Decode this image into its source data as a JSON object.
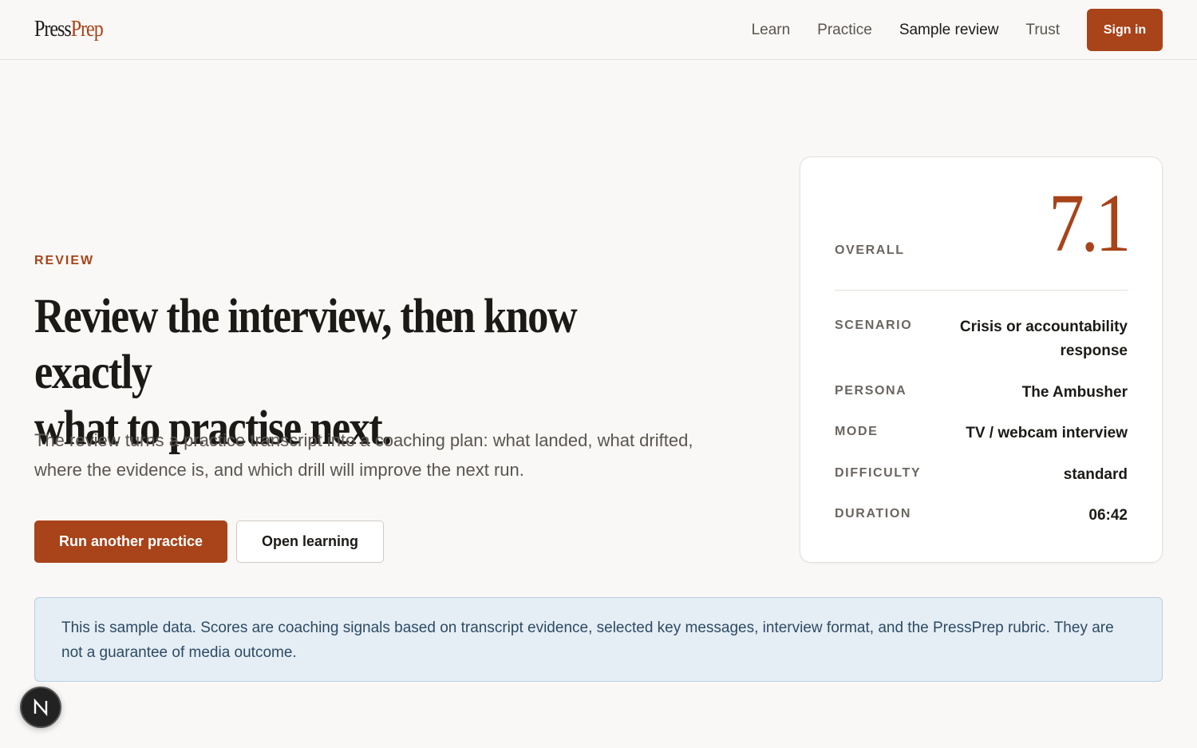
{
  "header": {
    "logo_press": "Press",
    "logo_prep": "Prep",
    "nav": [
      "Learn",
      "Practice",
      "Sample review",
      "Trust"
    ],
    "active_nav": "Sample review",
    "signin_label": "Sign in"
  },
  "hero": {
    "eyebrow": "REVIEW",
    "headline": "Review the interview, then know exactly\nwhat to practise next.",
    "lede": "The review turns a practice transcript into a coaching plan: what landed, what drifted, where the evidence is, and which drill will improve the next run.",
    "primary_cta": "Run another practice",
    "secondary_cta": "Open learning"
  },
  "card": {
    "overall_label": "OVERALL",
    "overall_score": "7.1",
    "rows": [
      {
        "key": "SCENARIO",
        "value": "Crisis or accountability response"
      },
      {
        "key": "PERSONA",
        "value": "The Ambusher"
      },
      {
        "key": "MODE",
        "value": "TV / webcam interview"
      },
      {
        "key": "DIFFICULTY",
        "value": "standard"
      },
      {
        "key": "DURATION",
        "value": "06:42"
      }
    ]
  },
  "notice": {
    "text": "This is sample data. Scores are coaching signals based on transcript evidence, selected key messages, interview format, and the PressPrep rubric. They are not a guarantee of media outcome."
  },
  "fab": {
    "icon": "n-logo-icon",
    "letter": "N"
  },
  "colors": {
    "accent": "#a8431a",
    "background": "#f9f8f6",
    "notice_bg": "#e5eef5",
    "notice_text": "#2e4a63"
  }
}
